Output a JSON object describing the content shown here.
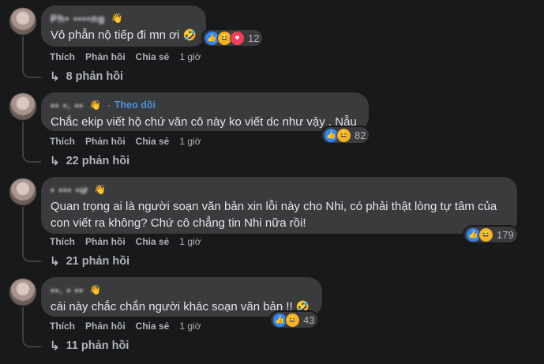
{
  "comments": [
    {
      "author": "Ph▪ ▪▪▪▪ng",
      "follow": "",
      "text": "Vô phẫn nộ tiếp đi mn ơi",
      "text_emoji": "🤣",
      "reactions": [
        "like",
        "haha",
        "love"
      ],
      "reaction_count": "12",
      "actions": {
        "like": "Thích",
        "reply": "Phản hồi",
        "share": "Chia sẻ",
        "time": "1 giờ"
      },
      "replies": "8 phản hồi"
    },
    {
      "author": "▪▪ ▪. ▪▪",
      "follow": "Theo dõi",
      "text": "Chắc ekip viết hộ chứ văn cô này ko viết dc như vậy . Nẫu",
      "text_emoji": "",
      "reactions": [
        "like",
        "haha"
      ],
      "reaction_count": "82",
      "actions": {
        "like": "Thích",
        "reply": "Phản hồi",
        "share": "Chia sẻ",
        "time": "1 giờ"
      },
      "replies": "22 phản hồi"
    },
    {
      "author": "▪ ▪▪▪ ▪ư",
      "follow": "",
      "text": "Quan trọng ai là người soạn văn bản xin lỗi này cho Nhi, có phải thật lòng tự tâm của con viết ra không? Chứ cô chẳng tin Nhi nữa rồi!",
      "text_emoji": "",
      "reactions": [
        "like",
        "haha"
      ],
      "reaction_count": "179",
      "actions": {
        "like": "Thích",
        "reply": "Phản hồi",
        "share": "Chia sẻ",
        "time": "1 giờ"
      },
      "replies": "21 phản hồi"
    },
    {
      "author": "▪▪. ▪ ▪▪",
      "follow": "",
      "text": "cái này chắc chắn người khác soạn văn bản !!",
      "text_emoji": "🤣",
      "reactions": [
        "like",
        "haha"
      ],
      "reaction_count": "43",
      "actions": {
        "like": "Thích",
        "reply": "Phản hồi",
        "share": "Chia sẻ",
        "time": "1 giờ"
      },
      "replies": "11 phản hồi"
    }
  ],
  "icons": {
    "badge": "waving-hand-icon",
    "like": "thumbs-up-icon",
    "haha": "laughing-face-icon",
    "love": "heart-icon",
    "reply": "reply-arrow-icon"
  },
  "colors": {
    "background": "#18191a",
    "bubble": "#3a3b3c",
    "link": "#4a90e2",
    "like": "#2d88ff",
    "haha": "#f7b125",
    "love": "#f33e58"
  }
}
